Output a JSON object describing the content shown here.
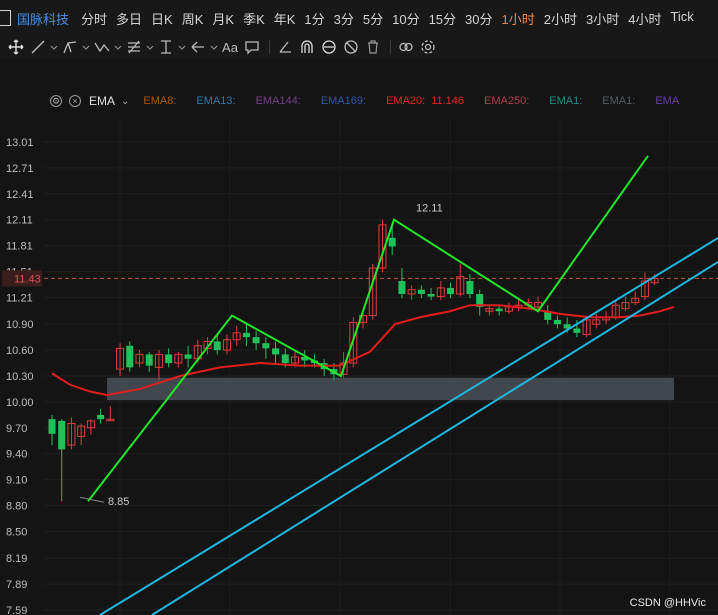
{
  "header": {
    "stock_name": "国脉科技",
    "timeframes": [
      "分时",
      "多日",
      "日K",
      "周K",
      "月K",
      "季K",
      "年K",
      "1分",
      "3分",
      "5分",
      "10分",
      "15分",
      "30分",
      "1小时",
      "2小时",
      "3小时",
      "4小时",
      "Tick"
    ],
    "active_timeframe": "1小时"
  },
  "indicator_bar": {
    "name": "EMA",
    "items": [
      {
        "label": "EMA8:",
        "value": "",
        "color": "#a85a12"
      },
      {
        "label": "EMA13:",
        "value": "",
        "color": "#2e7aa8"
      },
      {
        "label": "EMA144:",
        "value": "",
        "color": "#7b3f8a"
      },
      {
        "label": "EMA169:",
        "value": "",
        "color": "#2f5aa8"
      },
      {
        "label": "EMA20:",
        "value": "11.146",
        "color": "#e02a2a"
      },
      {
        "label": "EMA250:",
        "value": "",
        "color": "#a8434b"
      },
      {
        "label": "EMA1:",
        "value": "",
        "color": "#2b8a8a"
      },
      {
        "label": "EMA1:",
        "value": "",
        "color": "#555b60"
      },
      {
        "label": "EMA",
        "value": "",
        "color": "#6a3fa8"
      }
    ]
  },
  "axis": {
    "ticks": [
      "13.01",
      "12.71",
      "12.41",
      "12.11",
      "11.81",
      "11.51",
      "11.21",
      "10.90",
      "10.60",
      "10.30",
      "10.00",
      "9.70",
      "9.40",
      "9.10",
      "8.80",
      "8.50",
      "8.19",
      "7.89",
      "7.59"
    ],
    "current_price": "11.43"
  },
  "annotations": {
    "high_label": "12.11",
    "low_label": "8.85"
  },
  "watermark": "CSDN @HHVic"
}
